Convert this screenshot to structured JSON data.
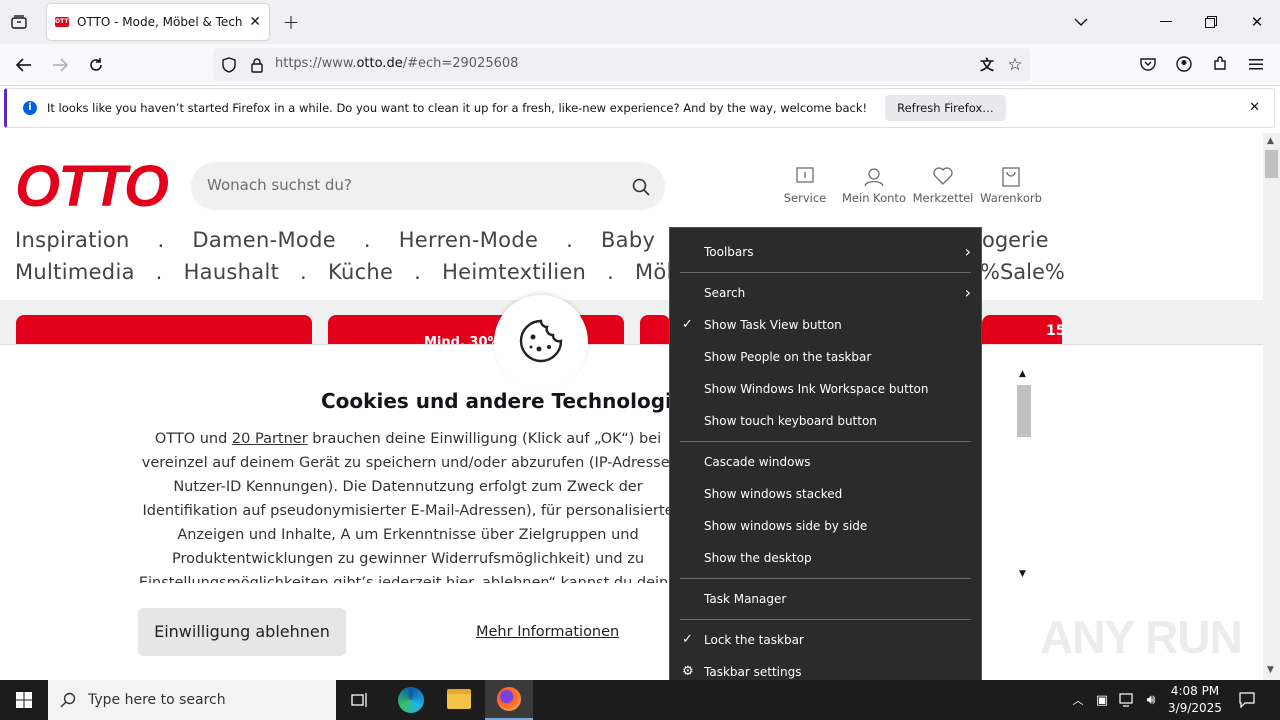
{
  "browser": {
    "tab_title": "OTTO - Mode, Möbel & Technik",
    "tab_favicon_text": "OTTO",
    "url_prefix": "https://www.",
    "url_domain": "otto.de",
    "url_suffix": "/#ech=29025608"
  },
  "notification": {
    "message": "It looks like you haven’t started Firefox in a while. Do you want to clean it up for a fresh, like-new experience? And by the way, welcome back!",
    "button": "Refresh Firefox…"
  },
  "site": {
    "logo": "OTTO",
    "search_placeholder": "Wonach suchst du?",
    "header_icons": [
      {
        "label": "Service",
        "icon": "service-icon"
      },
      {
        "label": "Mein Konto",
        "icon": "account-icon"
      },
      {
        "label": "Merkzettel",
        "icon": "heart-icon"
      },
      {
        "label": "Warenkorb",
        "icon": "cart-icon"
      }
    ],
    "nav_row1": "Inspiration    .    Damen-Mode    .    Herren-Mode    .    Baby",
    "nav_row1_tail": "ogerie",
    "nav_row2": "Multimedia   .   Haushalt   .   Küche   .   Heimtextilien   .   Möbel",
    "nav_row2_tail": "%Sale%",
    "promo_fragment": "Mind. 30%",
    "promo_fragment2": "15"
  },
  "cookie": {
    "title": "Cookies und andere Technologien er",
    "body_before_link": "OTTO und ",
    "link_partners": "20 Partner",
    "body_after_link": " brauchen deine Einwilligung (Klick auf „OK“) bei vereinzel auf deinem Gerät zu speichern und/oder abzurufen (IP-Adresse, Nutzer-ID Kennungen). Die Datennutzung erfolgt zum Zweck der Identifikation auf pseudonymisierter E-Mail-Adressen), für personalisierte Anzeigen und Inhalte, A um Erkenntnisse über Zielgruppen und Produktentwicklungen zu gewinner Widerrufsmöglichkeit) und zu Einstellungsmöglichkeiten gibt’s jederzeit ",
    "link_here": "hier",
    "body_end": ". ablehnen“ kannst du deine Einwilligung jederzeit a",
    "decline_button": "Einwilligung ablehnen",
    "more_link": "Mehr Informationen"
  },
  "context_menu": {
    "items": [
      {
        "label": "Toolbars",
        "submenu": true,
        "checked": false
      },
      {
        "label": "Search",
        "submenu": true,
        "checked": false
      },
      {
        "label": "Show Task View button",
        "submenu": false,
        "checked": true
      },
      {
        "label": "Show People on the taskbar",
        "submenu": false,
        "checked": false
      },
      {
        "label": "Show Windows Ink Workspace button",
        "submenu": false,
        "checked": false
      },
      {
        "label": "Show touch keyboard button",
        "submenu": false,
        "checked": false
      },
      {
        "label": "Cascade windows",
        "submenu": false,
        "checked": false
      },
      {
        "label": "Show windows stacked",
        "submenu": false,
        "checked": false
      },
      {
        "label": "Show windows side by side",
        "submenu": false,
        "checked": false
      },
      {
        "label": "Show the desktop",
        "submenu": false,
        "checked": false
      },
      {
        "label": "Task Manager",
        "submenu": false,
        "checked": false
      },
      {
        "label": "Lock the taskbar",
        "submenu": false,
        "checked": true
      },
      {
        "label": "Taskbar settings",
        "submenu": false,
        "checked": false
      }
    ]
  },
  "taskbar": {
    "search_placeholder": "Type here to search",
    "time": "4:08 PM",
    "date": "3/9/2025"
  },
  "watermark": "ANY RUN",
  "colors": {
    "otto_red": "#e2001a",
    "menu_bg": "#2b2b2b",
    "taskbar_bg": "#1c1c1c"
  }
}
